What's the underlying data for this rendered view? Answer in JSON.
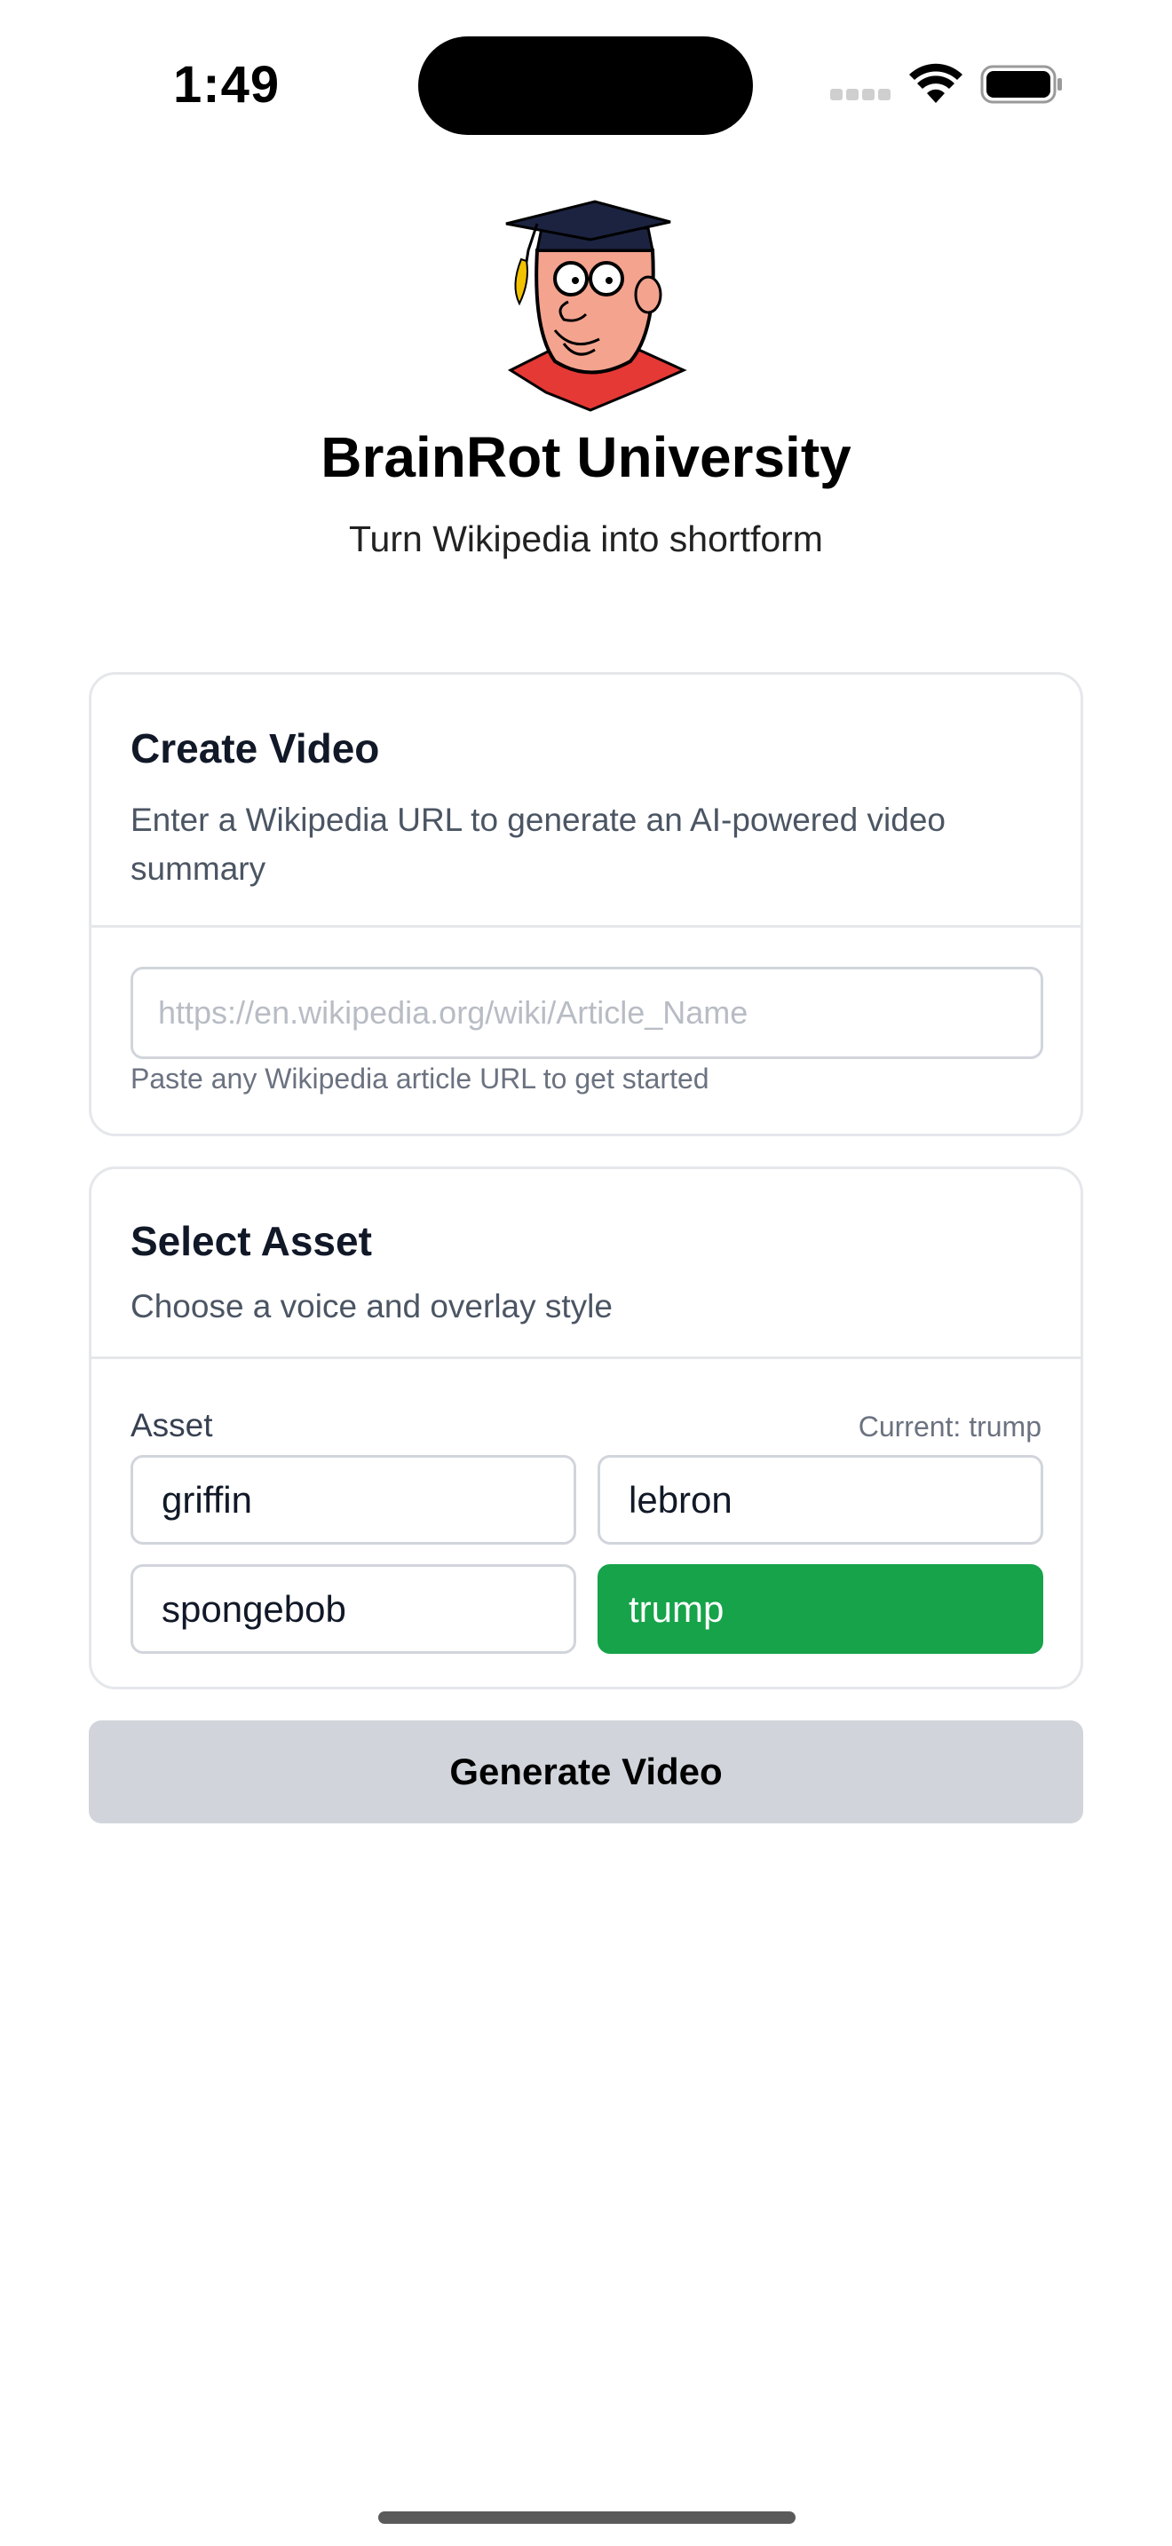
{
  "status_bar": {
    "time": "1:49"
  },
  "header": {
    "logo_icon": "graduation-cap-mascot-icon",
    "title": "BrainRot University",
    "subtitle": "Turn Wikipedia into shortform"
  },
  "create_video": {
    "title": "Create Video",
    "description": "Enter a Wikipedia URL to generate an AI-powered video summary",
    "url_input": {
      "value": "",
      "placeholder": "https://en.wikipedia.org/wiki/Article_Name"
    },
    "hint": "Paste any Wikipedia article URL to get started"
  },
  "select_asset": {
    "title": "Select Asset",
    "description": "Choose a voice and overlay style",
    "field_label": "Asset",
    "current_label": "Current: trump",
    "options": [
      {
        "label": "griffin",
        "selected": false
      },
      {
        "label": "lebron",
        "selected": false
      },
      {
        "label": "spongebob",
        "selected": false
      },
      {
        "label": "trump",
        "selected": true
      }
    ],
    "selected_color": "#16a34a"
  },
  "generate_button": {
    "label": "Generate Video",
    "color": "#d1d5db"
  }
}
